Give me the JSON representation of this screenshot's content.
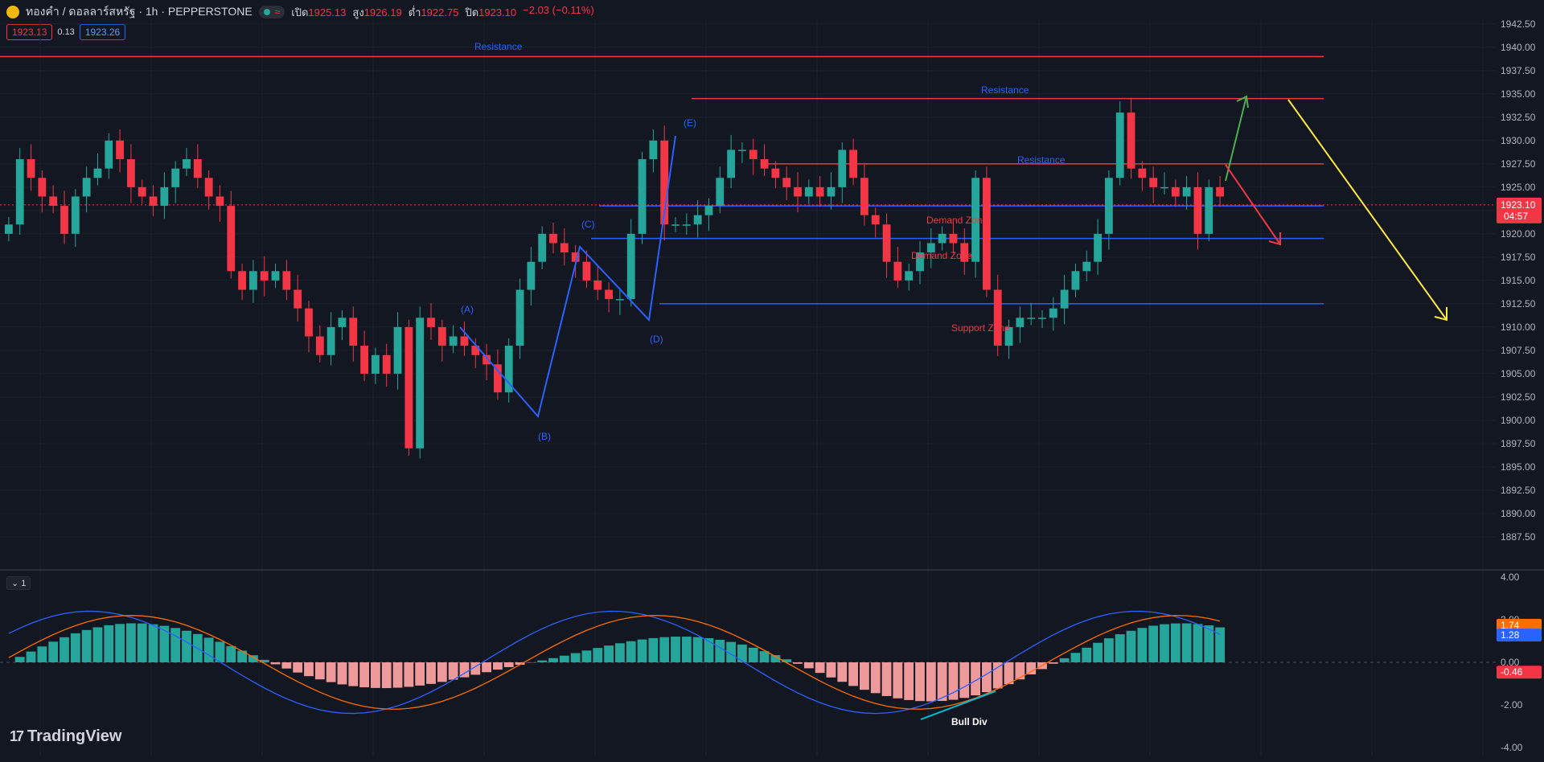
{
  "header": {
    "symbol": "ทองคำ / ดอลลาร์สหรัฐ · 1h · PEPPERSTONE",
    "open_label": "เปิด",
    "open": "1925.13",
    "high_label": "สูง",
    "high": "1926.19",
    "low_label": "ต่ำ",
    "low": "1922.75",
    "close_label": "ปิด",
    "close": "1923.10",
    "change": "−2.03 (−0.11%)"
  },
  "quote": {
    "bid": "1923.13",
    "spread": "0.13",
    "ask": "1923.26"
  },
  "colors": {
    "up": "#26a69a",
    "down": "#f23645",
    "blue": "#2962ff",
    "bg": "#131722"
  },
  "chart_data": [
    {
      "type": "candlestick",
      "ylim": [
        1885,
        1943
      ],
      "y_ticks": [
        "1942.50",
        "1940.00",
        "1937.50",
        "1935.00",
        "1932.50",
        "1930.00",
        "1927.50",
        "1925.00",
        "1922.50",
        "1920.00",
        "1917.50",
        "1915.00",
        "1912.50",
        "1910.00",
        "1907.50",
        "1905.00",
        "1902.50",
        "1900.00",
        "1897.50",
        "1895.00",
        "1892.50",
        "1890.00",
        "1887.50"
      ],
      "last_price": "1923.10",
      "countdown": "04:57",
      "close_path": [
        1921,
        1928,
        1926,
        1924,
        1923,
        1920,
        1924,
        1926,
        1927,
        1930,
        1928,
        1925,
        1924,
        1923,
        1925,
        1927,
        1928,
        1926,
        1924,
        1923,
        1916,
        1914,
        1916,
        1915,
        1916,
        1914,
        1912,
        1909,
        1907,
        1910,
        1911,
        1908,
        1905,
        1907,
        1905,
        1910,
        1897,
        1911,
        1910,
        1908,
        1909,
        1908,
        1907,
        1906,
        1903,
        1908,
        1914,
        1917,
        1920,
        1919,
        1918,
        1917,
        1915,
        1914,
        1913,
        1913,
        1920,
        1928,
        1930,
        1921,
        1921,
        1921,
        1922,
        1923,
        1926,
        1929,
        1929,
        1928,
        1927,
        1926,
        1925,
        1924,
        1925,
        1924,
        1925,
        1929,
        1926,
        1922,
        1921,
        1917,
        1915,
        1916,
        1918,
        1919,
        1920,
        1919,
        1917,
        1926,
        1914,
        1908,
        1910,
        1911,
        1911,
        1911,
        1912,
        1914,
        1916,
        1917,
        1920,
        1926,
        1933,
        1927,
        1926,
        1925,
        1925,
        1924,
        1925,
        1920,
        1925,
        1924
      ],
      "annotations": [
        {
          "text": "Resistance",
          "color": "#2962ff"
        },
        {
          "text": "Resistance",
          "color": "#2962ff"
        },
        {
          "text": "Resistance",
          "color": "#2962ff"
        },
        {
          "text": "Demand Zone",
          "color": "#f23645"
        },
        {
          "text": "Demand Zone",
          "color": "#f23645"
        },
        {
          "text": "Support Zone",
          "color": "#f23645"
        },
        {
          "text": "(A)",
          "color": "#2962ff"
        },
        {
          "text": "(B)",
          "color": "#2962ff"
        },
        {
          "text": "(C)",
          "color": "#2962ff"
        },
        {
          "text": "(D)",
          "color": "#2962ff"
        },
        {
          "text": "(E)",
          "color": "#2962ff"
        }
      ],
      "levels": [
        1939,
        1934.5,
        1927.5,
        1923,
        1919.5,
        1912.5
      ]
    },
    {
      "type": "macd",
      "ylim": [
        -4,
        4
      ],
      "y_ticks": [
        "4.00",
        "2.00",
        "0.00",
        "-2.00",
        "-4.00"
      ],
      "values": {
        "signal": "1.74",
        "macd": "1.28",
        "histogram": "-0.46"
      },
      "annotation": "Bull Div",
      "pane_label": "1"
    }
  ],
  "branding": {
    "name": "TradingView"
  }
}
